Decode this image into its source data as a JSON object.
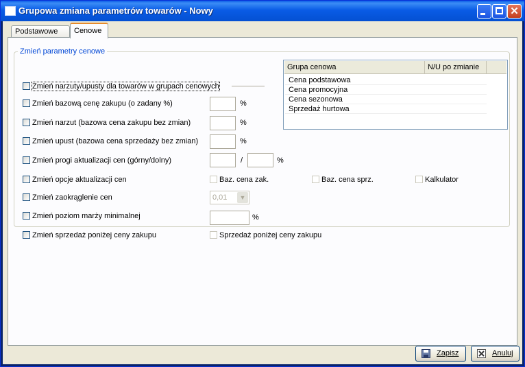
{
  "window": {
    "title": "Grupowa zmiana parametrów towarów - Nowy",
    "icon": "window-icon",
    "minimize_icon": "minimize-icon",
    "maximize_icon": "maximize-icon",
    "close_icon": "close-icon"
  },
  "tabs": [
    {
      "label": "Podstawowe",
      "active": false
    },
    {
      "label": "Cenowe",
      "active": true
    }
  ],
  "group": {
    "legend": "Zmień parametry cenowe"
  },
  "options": {
    "narzuty_grupy": "Zmień narzuty/upusty dla towarów w grupach cenowych",
    "cena_zakupu": "Zmień bazową cenę zakupu (o zadany %)",
    "narzut": "Zmień narzut (bazowa cena zakupu bez zmian)",
    "upust": "Zmień upust (bazowa cena sprzedaży bez zmian)",
    "progi": "Zmień progi aktualizacji cen (górny/dolny)",
    "opcje_aktualizacji": "Zmień opcje aktualizacji cen",
    "zaokraglenie": "Zmień zaokrąglenie cen",
    "marza": "Zmień poziom marży minimalnej",
    "sprzedaz_ponizej": "Zmień sprzedaż poniżej ceny zakupu"
  },
  "sub_options": {
    "baz_cena_zak": "Baz. cena zak.",
    "baz_cena_sprz": "Baz. cena sprz.",
    "kalkulator": "Kalkulator",
    "sprzedaz_ponizej": "Sprzedaż poniżej ceny zakupu"
  },
  "units": {
    "percent": "%",
    "slash": "/"
  },
  "rounding": {
    "value": "0,01"
  },
  "grid": {
    "columns": [
      "Grupa cenowa",
      "N/U po zmianie"
    ],
    "rows": [
      "Cena podstawowa",
      "Cena promocyjna",
      "Cena sezonowa",
      "Sprzedaż hurtowa"
    ]
  },
  "buttons": {
    "save": "Zapisz",
    "cancel": "Anuluj"
  },
  "colors": {
    "title_bar": "#0a5ce6",
    "legend_text": "#0046d5",
    "active_tab_accent": "#e68b2c",
    "face": "#ece9d8"
  }
}
